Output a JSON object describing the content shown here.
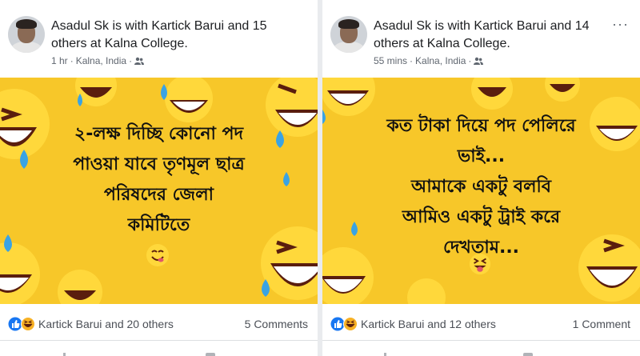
{
  "posts": [
    {
      "author": "Asadul Sk",
      "with_text": "is with",
      "tagged": "Kartick Barui",
      "and_text": "and",
      "others": "15 others",
      "at_text": "at",
      "place": "Kalna College.",
      "time": "1 hr",
      "location": "Kalna, India",
      "privacy_icon": "friends-icon",
      "caption_lines": [
        "২-লক্ষ দিচ্ছি কোনো পদ",
        "পাওয়া যাবে তৃণমূল ছাত্র",
        "পরিষদের জেলা",
        "কমিটিতে"
      ],
      "caption_emoji": "😋",
      "reaction_names": "Kartick Barui and 20 others",
      "comments": "5 Comments"
    },
    {
      "author": "Asadul Sk",
      "with_text": "is with",
      "tagged": "Kartick Barui",
      "and_text": "and",
      "others": "14 others",
      "at_text": "at",
      "place": "Kalna College.",
      "time": "55 mins",
      "location": "Kalna, India",
      "privacy_icon": "friends-icon",
      "caption_lines": [
        "কত টাকা দিয়ে পদ পেলিরে",
        "ভাই...",
        "আমাকে একটু বলবি",
        "আমিও একটু ট্রাই করে",
        "দেখতাম..."
      ],
      "caption_emoji": "😝",
      "reaction_names": "Kartick Barui and 12 others",
      "comments": "1 Comment"
    }
  ],
  "colors": {
    "meme_bg": "#f7c729",
    "emoji_face": "#ffd83b",
    "tear": "#3aa3e3",
    "like_blue": "#1877f2",
    "haha_yellow": "#f7b125"
  },
  "reaction_icons": [
    "like-icon",
    "haha-icon"
  ],
  "menu_icon": "more-icon"
}
